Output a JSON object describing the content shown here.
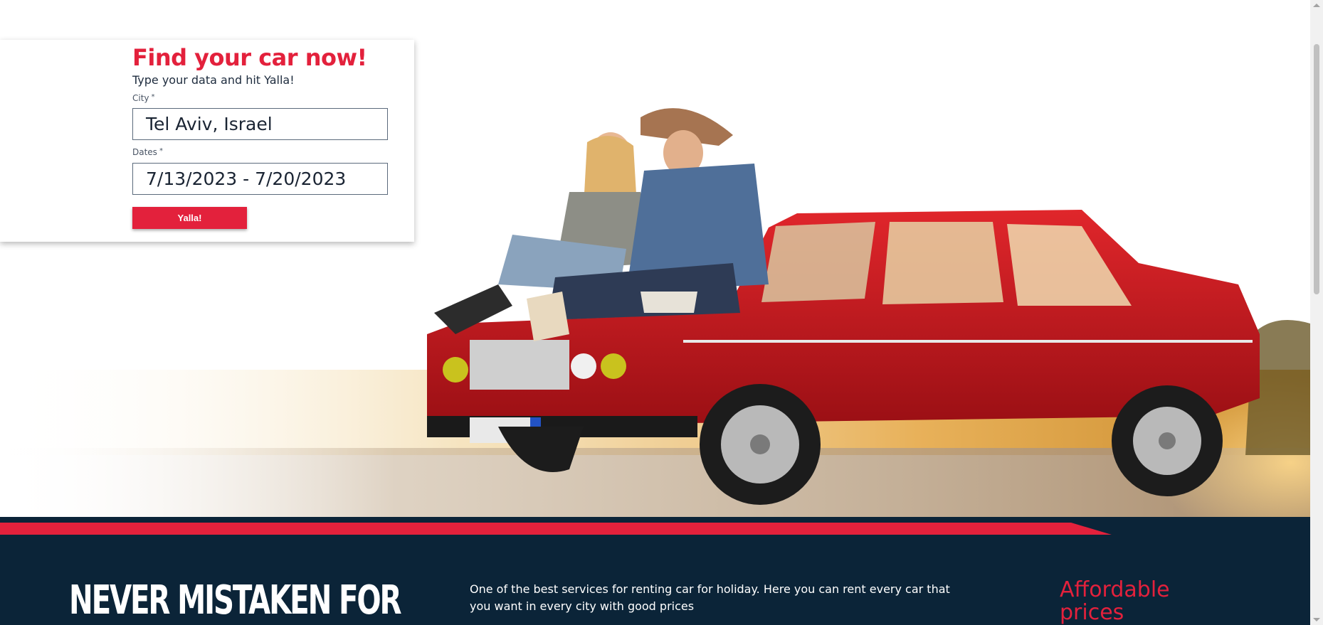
{
  "search": {
    "title": "Find your car now!",
    "subtitle": "Type your data and hit Yalla!",
    "city_label": "City",
    "city_value": "Tel Aviv, Israel",
    "dates_label": "Dates",
    "dates_value": "7/13/2023 - 7/20/2023",
    "required_marker": "*",
    "submit_label": "Yalla!"
  },
  "about": {
    "headline": "NEVER MISTAKEN FOR",
    "description": "One of the best services for renting car for holiday. Here you can rent every car that you want in every city with good prices",
    "feature_title": "Affordable prices"
  },
  "colors": {
    "accent": "#e3213c",
    "navy": "#0b2438",
    "car_red": "#c8161c"
  },
  "icons": {
    "scroll_up": "scroll-up-arrow-icon",
    "scroll_down": "scroll-down-arrow-icon"
  }
}
